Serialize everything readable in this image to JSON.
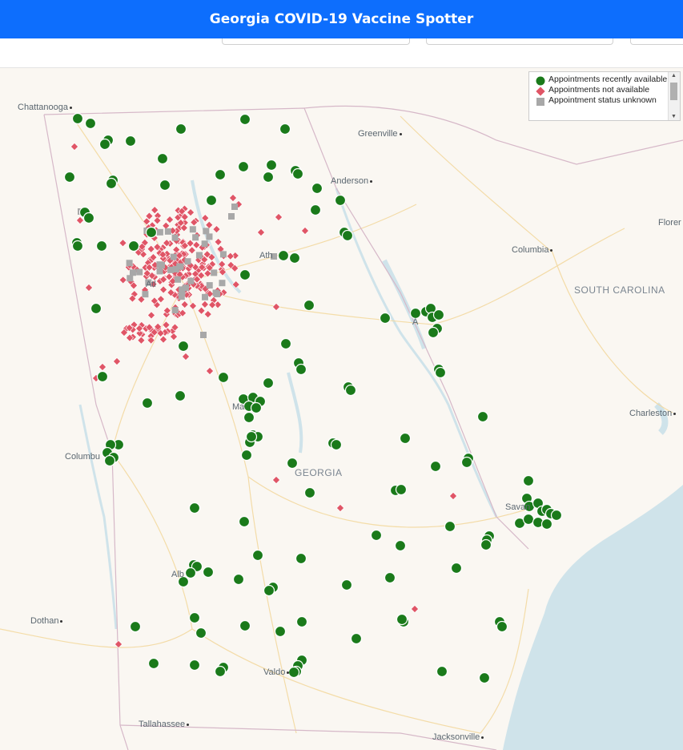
{
  "header": {
    "title": "Georgia COVID-19 Vaccine Spotter"
  },
  "legend": {
    "available": "Appointments recently available",
    "unavailable": "Appointments not available",
    "unknown": "Appointment status unknown"
  },
  "colors": {
    "available": "#1a7a1a",
    "unavailable": "#e05566",
    "unknown": "#a8a8a8",
    "header": "#0d6efd",
    "water": "#cfe3ea"
  },
  "places": {
    "chattanooga": "Chattanooga",
    "greenville": "Greenville",
    "anderson": "Anderson",
    "florence": "Florer",
    "columbia": "Columbia",
    "charleston": "Charleston",
    "atlanta": "Atl",
    "athens": "Ath",
    "augusta": "A",
    "macon": "Ma",
    "columbus": "Columbu",
    "savannah": "Savan",
    "albany": "Alb",
    "dothan": "Dothan",
    "valdosta": "Valdo",
    "tallahassee": "Tallahassee",
    "jacksonville": "Jacksonville"
  },
  "states": {
    "sc": "SOUTH CAROLINA",
    "ga": "GEORGIA"
  }
}
